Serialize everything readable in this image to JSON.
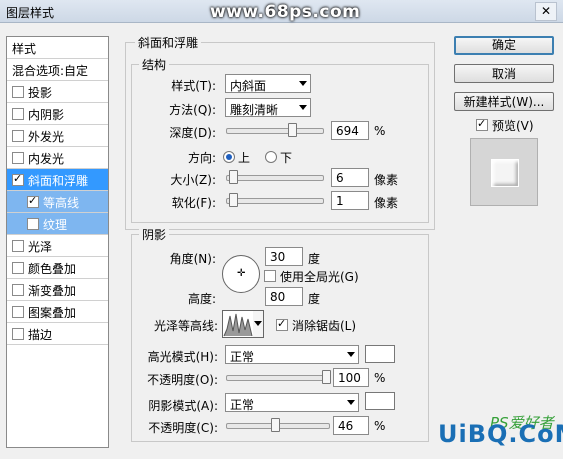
{
  "window": {
    "title": "图层样式",
    "watermark_top": "www.68ps.com",
    "close": "✕"
  },
  "left_list": {
    "header": "样式",
    "blend": "混合选项:自定",
    "items": [
      {
        "label": "投影",
        "checked": false
      },
      {
        "label": "内阴影",
        "checked": false
      },
      {
        "label": "外发光",
        "checked": false
      },
      {
        "label": "内发光",
        "checked": false
      },
      {
        "label": "斜面和浮雕",
        "checked": true
      },
      {
        "label": "等高线",
        "checked": true
      },
      {
        "label": "纹理",
        "checked": false
      },
      {
        "label": "光泽",
        "checked": false
      },
      {
        "label": "颜色叠加",
        "checked": false
      },
      {
        "label": "渐变叠加",
        "checked": false
      },
      {
        "label": "图案叠加",
        "checked": false
      },
      {
        "label": "描边",
        "checked": false
      }
    ]
  },
  "bevel": {
    "group_title": "斜面和浮雕",
    "structure_title": "结构",
    "style_label": "样式(T):",
    "style_value": "内斜面",
    "method_label": "方法(Q):",
    "method_value": "雕刻清晰",
    "depth_label": "深度(D):",
    "depth_value": "694",
    "depth_unit": "%",
    "depth_slider": 0.69,
    "direction_label": "方向:",
    "direction_up": "上",
    "direction_down": "下",
    "size_label": "大小(Z):",
    "size_value": "6",
    "size_unit": "像素",
    "size_slider": 0.02,
    "soften_label": "软化(F):",
    "soften_value": "1",
    "soften_unit": "像素",
    "soften_slider": 0.02
  },
  "shading": {
    "title": "阴影",
    "angle_label": "角度(N):",
    "angle_value": "30",
    "angle_unit": "度",
    "global_light": "使用全局光(G)",
    "altitude_label": "高度:",
    "altitude_value": "80",
    "altitude_unit": "度",
    "gloss_label": "光泽等高线:",
    "antialias": "消除锯齿(L)",
    "highlight_mode_label": "高光模式(H):",
    "highlight_mode": "正常",
    "highlight_opacity_label": "不透明度(O):",
    "highlight_opacity": "100",
    "highlight_opacity_unit": "%",
    "highlight_opacity_slider": 1.0,
    "shadow_mode_label": "阴影模式(A):",
    "shadow_mode": "正常",
    "shadow_opacity_label": "不透明度(C):",
    "shadow_opacity": "46",
    "shadow_opacity_unit": "%",
    "shadow_opacity_slider": 0.46
  },
  "buttons": {
    "ok": "确定",
    "cancel": "取消",
    "new_style": "新建样式(W)...",
    "preview": "预览(V)"
  },
  "watermark_bottom": {
    "logo": "UiBQ.CoM",
    "cn": "PS爱好者"
  }
}
